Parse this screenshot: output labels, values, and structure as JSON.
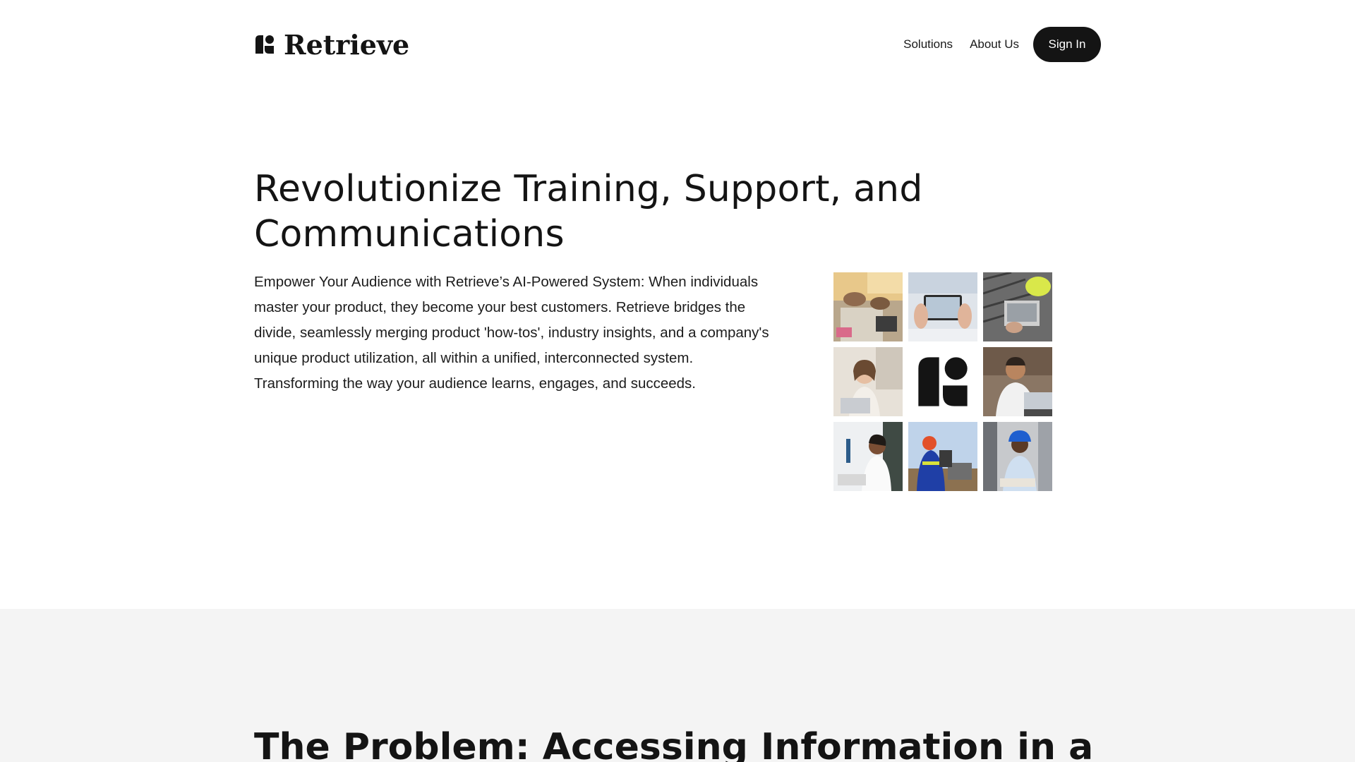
{
  "brand": {
    "name": "Retrieve",
    "logo_icon": "retrieve-logo-mark"
  },
  "nav": {
    "solutions": "Solutions",
    "about": "About Us",
    "signin": "Sign In"
  },
  "hero": {
    "title": "Revolutionize Training, Support, and Communications",
    "body": "Empower Your Audience with Retrieve’s AI-Powered System: When individuals master your product, they become your best customers. Retrieve bridges the divide, seamlessly merging product 'how-tos', industry insights, and a company's unique product utilization, all within a unified, interconnected system. Transforming the way your audience learns, engages, and succeeds."
  },
  "photo_grid": {
    "tiles": [
      "team-planning-photo",
      "tablet-in-hands-photo",
      "laptop-typing-photo",
      "headset-support-agent-photo",
      "retrieve-logo-mark",
      "man-on-phone-photo",
      "lab-scientist-photo",
      "field-worker-tablet-photo",
      "engineer-hardhat-photo"
    ]
  },
  "problem": {
    "title": "The Problem: Accessing Information in a"
  },
  "colors": {
    "ink": "#141414",
    "band": "#f4f4f4",
    "button": "#141414"
  }
}
